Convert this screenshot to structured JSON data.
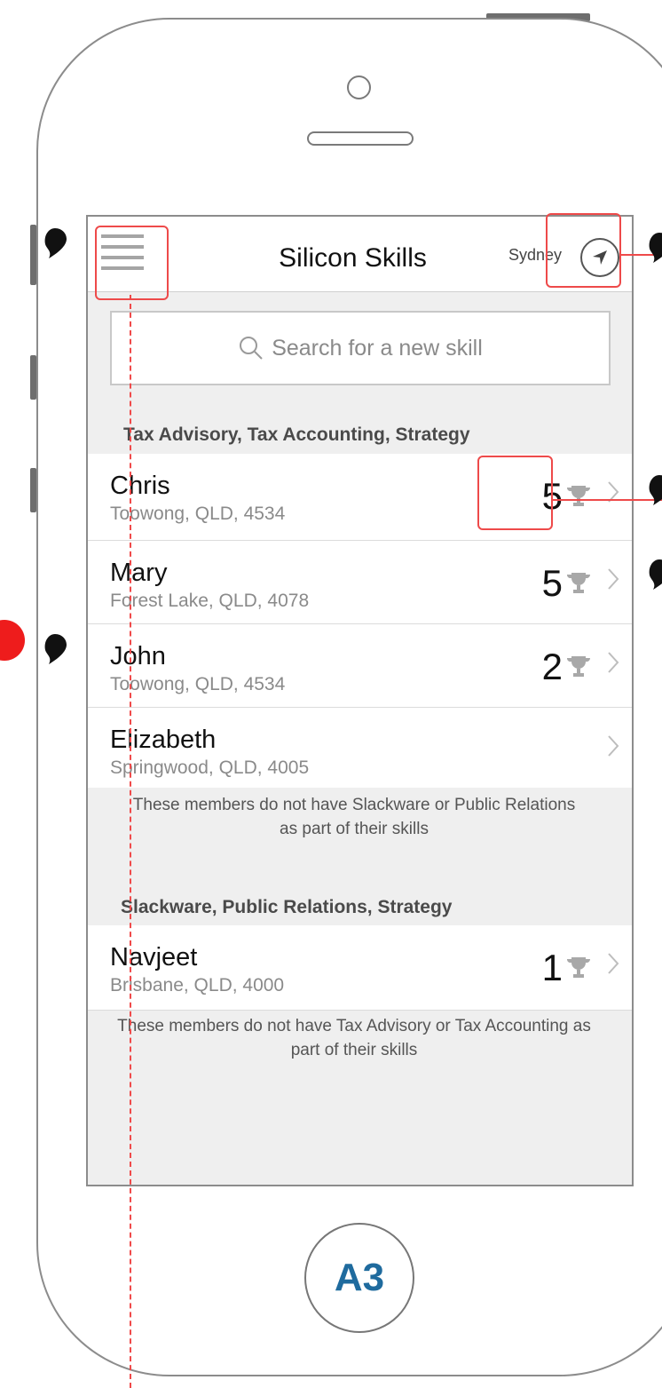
{
  "header": {
    "title": "Silicon Skills",
    "city": "Sydney"
  },
  "search": {
    "placeholder": "Search for a new skill"
  },
  "sections": [
    {
      "title": "Tax Advisory, Tax Accounting, Strategy",
      "members": [
        {
          "name": "Chris",
          "address": "Toowong, QLD, 4534",
          "score": "5"
        },
        {
          "name": "Mary",
          "address": "Forest Lake, QLD, 4078",
          "score": "5"
        },
        {
          "name": "John",
          "address": "Toowong, QLD, 4534",
          "score": "2"
        },
        {
          "name": "Elizabeth",
          "address": "Springwood, QLD, 4005",
          "score": ""
        }
      ],
      "note": "These members do not have Slackware or Public Relations as part of their skills"
    },
    {
      "title": "Slackware, Public Relations, Strategy",
      "members": [
        {
          "name": "Navjeet",
          "address": "Brisbane, QLD, 4000",
          "score": "1"
        }
      ],
      "note": "These members do not have Tax Advisory or Tax Accounting as part of their skills"
    }
  ],
  "home_label": "A3",
  "colors": {
    "annotation": "#ee4a4a",
    "home_label": "#1f6b9e",
    "screen_bg": "#efefef"
  },
  "icons": [
    "hamburger-icon",
    "location-arrow-icon",
    "search-icon",
    "trophy-icon",
    "chevron-right-icon",
    "annotation-pin-icon"
  ]
}
